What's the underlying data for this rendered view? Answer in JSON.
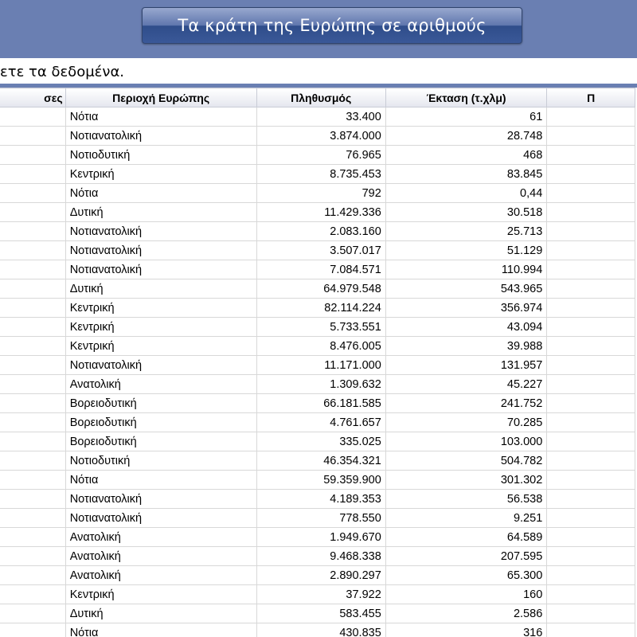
{
  "header": {
    "title": "Τα κράτη της Ευρώπης σε αριθμούς"
  },
  "instructions": "ετε τα δεδομένα.",
  "table": {
    "columns": [
      "σες",
      "Περιοχή Ευρώπης",
      "Πληθυσμός",
      "Έκταση (τ.χλμ)",
      "Π"
    ],
    "rows": [
      [
        "",
        "Νότια",
        "33.400",
        "61",
        ""
      ],
      [
        "",
        "Νοτιανατολική",
        "3.874.000",
        "28.748",
        ""
      ],
      [
        "",
        "Νοτιοδυτική",
        "76.965",
        "468",
        ""
      ],
      [
        "",
        "Κεντρική",
        "8.735.453",
        "83.845",
        ""
      ],
      [
        "",
        "Νότια",
        "792",
        "0,44",
        ""
      ],
      [
        "",
        "Δυτική",
        "11.429.336",
        "30.518",
        ""
      ],
      [
        "",
        "Νοτιανατολική",
        "2.083.160",
        "25.713",
        ""
      ],
      [
        "",
        "Νοτιανατολική",
        "3.507.017",
        "51.129",
        ""
      ],
      [
        "",
        "Νοτιανατολική",
        "7.084.571",
        "110.994",
        ""
      ],
      [
        "",
        "Δυτική",
        "64.979.548",
        "543.965",
        ""
      ],
      [
        "",
        "Κεντρική",
        "82.114.224",
        "356.974",
        ""
      ],
      [
        "",
        "Κεντρική",
        "5.733.551",
        "43.094",
        ""
      ],
      [
        "",
        "Κεντρική",
        "8.476.005",
        "39.988",
        ""
      ],
      [
        "",
        "Νοτιανατολική",
        "11.171.000",
        "131.957",
        ""
      ],
      [
        "",
        "Ανατολική",
        "1.309.632",
        "45.227",
        ""
      ],
      [
        "",
        "Βορειοδυτική",
        "66.181.585",
        "241.752",
        ""
      ],
      [
        "",
        "Βορειοδυτική",
        "4.761.657",
        "70.285",
        ""
      ],
      [
        "",
        "Βορειοδυτική",
        "335.025",
        "103.000",
        ""
      ],
      [
        "",
        "Νοτιοδυτική",
        "46.354.321",
        "504.782",
        ""
      ],
      [
        "",
        "Νότια",
        "59.359.900",
        "301.302",
        ""
      ],
      [
        "",
        "Νοτιανατολική",
        "4.189.353",
        "56.538",
        ""
      ],
      [
        "",
        "Νοτιανατολική",
        "778.550",
        "9.251",
        ""
      ],
      [
        "",
        "Ανατολική",
        "1.949.670",
        "64.589",
        ""
      ],
      [
        "",
        "Ανατολική",
        "9.468.338",
        "207.595",
        ""
      ],
      [
        "",
        "Ανατολική",
        "2.890.297",
        "65.300",
        ""
      ],
      [
        "",
        "Κεντρική",
        "37.922",
        "160",
        ""
      ],
      [
        "",
        "Δυτική",
        "583.455",
        "2.586",
        ""
      ],
      [
        "",
        "Νότια",
        "430.835",
        "316",
        ""
      ],
      [
        "",
        "",
        "",
        "",
        ""
      ]
    ]
  }
}
